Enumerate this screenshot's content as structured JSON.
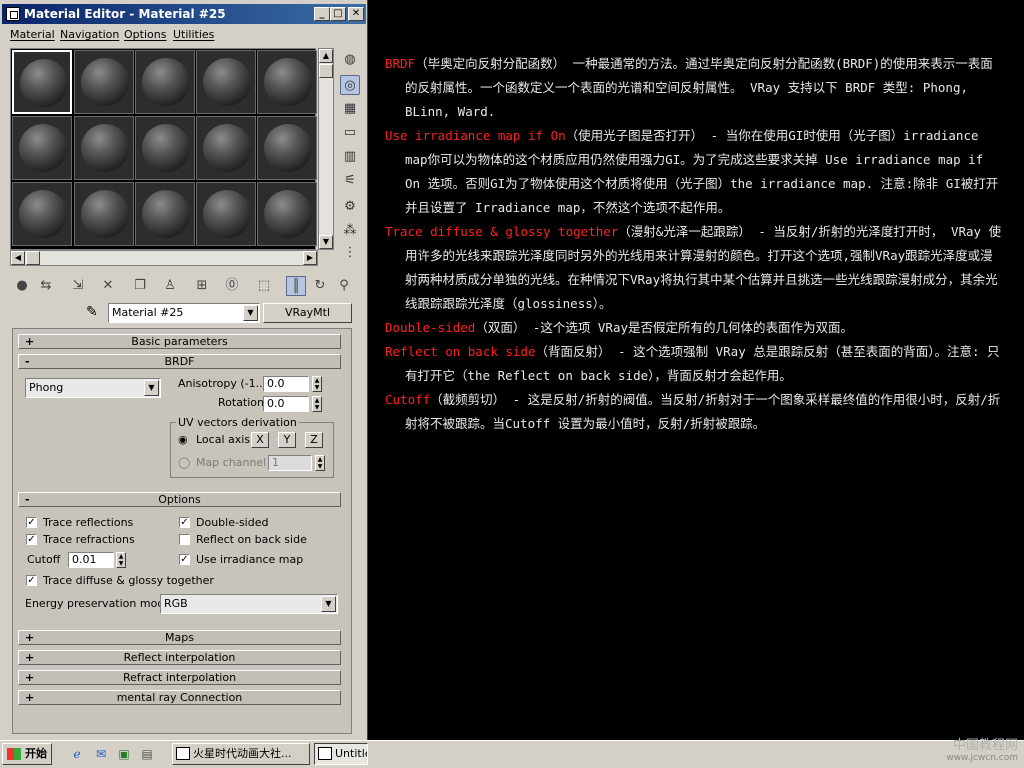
{
  "window": {
    "title": "Material Editor - Material #25",
    "minimize": "_",
    "maximize": "□",
    "close": "✕"
  },
  "menu": [
    "Material",
    "Navigation",
    "Options",
    "Utilities"
  ],
  "toolbar": {
    "material_name": "Material #25",
    "material_type": "VRayMtl"
  },
  "rollouts": {
    "basic": "Basic parameters",
    "brdf": "BRDF",
    "options": "Options",
    "maps": "Maps",
    "reflect_interp": "Reflect interpolation",
    "refract_interp": "Refract interpolation",
    "mental_ray": "mental ray Connection"
  },
  "brdf": {
    "type_value": "Phong",
    "anisotropy_label": "Anisotropy (-1..1)",
    "anisotropy_value": "0.0",
    "rotation_label": "Rotation",
    "rotation_value": "0.0",
    "uv_group_label": "UV vectors derivation",
    "local_axis_label": "Local axis",
    "axis_x": "X",
    "axis_y": "Y",
    "axis_z": "Z",
    "map_channel_label": "Map channel",
    "map_channel_value": "1"
  },
  "options": {
    "trace_reflections": "Trace reflections",
    "trace_refractions": "Trace refractions",
    "cutoff_label": "Cutoff",
    "cutoff_value": "0.01",
    "double_sided": "Double-sided",
    "reflect_back_side": "Reflect on back side",
    "use_irradiance": "Use irradiance map",
    "trace_diffuse_glossy": "Trace diffuse & glossy together",
    "energy_label": "Energy preservation mode:",
    "energy_value": "RGB"
  },
  "taskbar": {
    "start": "开始",
    "task1": "火星时代动画大社...",
    "task2": "Untitled"
  },
  "doc": {
    "p1_term": "BRDF",
    "p1_text": "（毕奥定向反射分配函数） 一种最通常的方法。通过毕奥定向反射分配函数(BRDF)的使用来表示一表面的反射属性。一个函数定义一个表面的光谱和空间反射属性。 VRay 支持以下 BRDF 类型: Phong, BLinn, Ward.",
    "p2_term": "Use irradiance map if On",
    "p2_text": "（使用光子图是否打开） - 当你在使用GI时使用（光子图）irradiance map你可以为物体的这个材质应用仍然使用强力GI。为了完成这些要求关掉 Use irradiance map if On 选项。否则GI为了物体使用这个材质将使用（光子图）the irradiance map. 注意:除非 GI被打开并且设置了 Irradiance map，不然这个选项不起作用。",
    "p3_term": "Trace diffuse & glossy together",
    "p3_text": "（漫射&光泽一起跟踪） - 当反射/折射的光泽度打开时， VRay 使用许多的光线来跟踪光泽度同时另外的光线用来计算漫射的颜色。打开这个选项,强制VRay跟踪光泽度或漫射两种材质成分单独的光线。在种情况下VRay将执行其中某个估算并且挑选一些光线跟踪漫射成分，其余光线跟踪跟踪光泽度（glossiness）。",
    "p4_term": "Double-sided",
    "p4_text": "（双面） -这个选项 VRay是否假定所有的几何体的表面作为双面。",
    "p5_term": "Reflect on back side",
    "p5_text": "（背面反射） - 这个选项强制 VRay 总是跟踪反射（甚至表面的背面）。注意: 只有打开它（the Reflect on back side），背面反射才会起作用。",
    "p6_term": "Cutoff",
    "p6_text": "（截频剪切） - 这是反射/折射的阀值。当反射/折射对于一个图象采样最终值的作用很小时，反射/折射将不被跟踪。当Cutoff 设置为最小值时，反射/折射被跟踪。"
  },
  "watermark": {
    "line1": "中国教程网",
    "line2": "www.jcwcn.com"
  }
}
